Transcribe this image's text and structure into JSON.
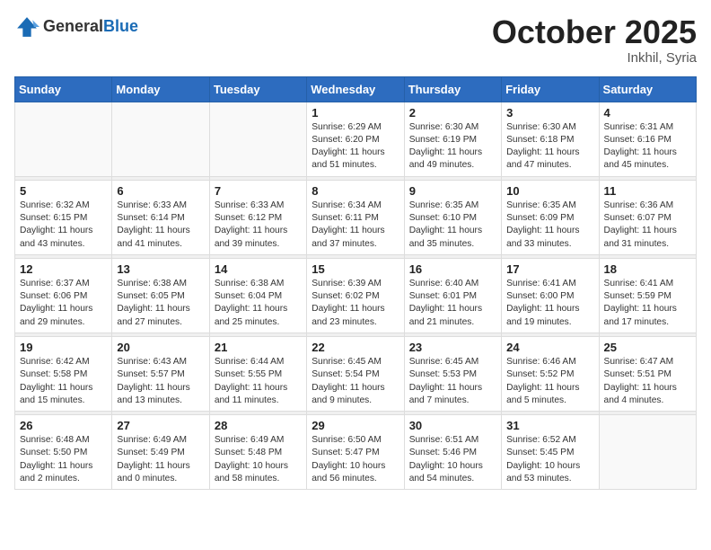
{
  "logo": {
    "general": "General",
    "blue": "Blue"
  },
  "title": "October 2025",
  "location": "Inkhil, Syria",
  "days_of_week": [
    "Sunday",
    "Monday",
    "Tuesday",
    "Wednesday",
    "Thursday",
    "Friday",
    "Saturday"
  ],
  "weeks": [
    [
      {
        "day": "",
        "info": ""
      },
      {
        "day": "",
        "info": ""
      },
      {
        "day": "",
        "info": ""
      },
      {
        "day": "1",
        "info": "Sunrise: 6:29 AM\nSunset: 6:20 PM\nDaylight: 11 hours\nand 51 minutes."
      },
      {
        "day": "2",
        "info": "Sunrise: 6:30 AM\nSunset: 6:19 PM\nDaylight: 11 hours\nand 49 minutes."
      },
      {
        "day": "3",
        "info": "Sunrise: 6:30 AM\nSunset: 6:18 PM\nDaylight: 11 hours\nand 47 minutes."
      },
      {
        "day": "4",
        "info": "Sunrise: 6:31 AM\nSunset: 6:16 PM\nDaylight: 11 hours\nand 45 minutes."
      }
    ],
    [
      {
        "day": "5",
        "info": "Sunrise: 6:32 AM\nSunset: 6:15 PM\nDaylight: 11 hours\nand 43 minutes."
      },
      {
        "day": "6",
        "info": "Sunrise: 6:33 AM\nSunset: 6:14 PM\nDaylight: 11 hours\nand 41 minutes."
      },
      {
        "day": "7",
        "info": "Sunrise: 6:33 AM\nSunset: 6:12 PM\nDaylight: 11 hours\nand 39 minutes."
      },
      {
        "day": "8",
        "info": "Sunrise: 6:34 AM\nSunset: 6:11 PM\nDaylight: 11 hours\nand 37 minutes."
      },
      {
        "day": "9",
        "info": "Sunrise: 6:35 AM\nSunset: 6:10 PM\nDaylight: 11 hours\nand 35 minutes."
      },
      {
        "day": "10",
        "info": "Sunrise: 6:35 AM\nSunset: 6:09 PM\nDaylight: 11 hours\nand 33 minutes."
      },
      {
        "day": "11",
        "info": "Sunrise: 6:36 AM\nSunset: 6:07 PM\nDaylight: 11 hours\nand 31 minutes."
      }
    ],
    [
      {
        "day": "12",
        "info": "Sunrise: 6:37 AM\nSunset: 6:06 PM\nDaylight: 11 hours\nand 29 minutes."
      },
      {
        "day": "13",
        "info": "Sunrise: 6:38 AM\nSunset: 6:05 PM\nDaylight: 11 hours\nand 27 minutes."
      },
      {
        "day": "14",
        "info": "Sunrise: 6:38 AM\nSunset: 6:04 PM\nDaylight: 11 hours\nand 25 minutes."
      },
      {
        "day": "15",
        "info": "Sunrise: 6:39 AM\nSunset: 6:02 PM\nDaylight: 11 hours\nand 23 minutes."
      },
      {
        "day": "16",
        "info": "Sunrise: 6:40 AM\nSunset: 6:01 PM\nDaylight: 11 hours\nand 21 minutes."
      },
      {
        "day": "17",
        "info": "Sunrise: 6:41 AM\nSunset: 6:00 PM\nDaylight: 11 hours\nand 19 minutes."
      },
      {
        "day": "18",
        "info": "Sunrise: 6:41 AM\nSunset: 5:59 PM\nDaylight: 11 hours\nand 17 minutes."
      }
    ],
    [
      {
        "day": "19",
        "info": "Sunrise: 6:42 AM\nSunset: 5:58 PM\nDaylight: 11 hours\nand 15 minutes."
      },
      {
        "day": "20",
        "info": "Sunrise: 6:43 AM\nSunset: 5:57 PM\nDaylight: 11 hours\nand 13 minutes."
      },
      {
        "day": "21",
        "info": "Sunrise: 6:44 AM\nSunset: 5:55 PM\nDaylight: 11 hours\nand 11 minutes."
      },
      {
        "day": "22",
        "info": "Sunrise: 6:45 AM\nSunset: 5:54 PM\nDaylight: 11 hours\nand 9 minutes."
      },
      {
        "day": "23",
        "info": "Sunrise: 6:45 AM\nSunset: 5:53 PM\nDaylight: 11 hours\nand 7 minutes."
      },
      {
        "day": "24",
        "info": "Sunrise: 6:46 AM\nSunset: 5:52 PM\nDaylight: 11 hours\nand 5 minutes."
      },
      {
        "day": "25",
        "info": "Sunrise: 6:47 AM\nSunset: 5:51 PM\nDaylight: 11 hours\nand 4 minutes."
      }
    ],
    [
      {
        "day": "26",
        "info": "Sunrise: 6:48 AM\nSunset: 5:50 PM\nDaylight: 11 hours\nand 2 minutes."
      },
      {
        "day": "27",
        "info": "Sunrise: 6:49 AM\nSunset: 5:49 PM\nDaylight: 11 hours\nand 0 minutes."
      },
      {
        "day": "28",
        "info": "Sunrise: 6:49 AM\nSunset: 5:48 PM\nDaylight: 10 hours\nand 58 minutes."
      },
      {
        "day": "29",
        "info": "Sunrise: 6:50 AM\nSunset: 5:47 PM\nDaylight: 10 hours\nand 56 minutes."
      },
      {
        "day": "30",
        "info": "Sunrise: 6:51 AM\nSunset: 5:46 PM\nDaylight: 10 hours\nand 54 minutes."
      },
      {
        "day": "31",
        "info": "Sunrise: 6:52 AM\nSunset: 5:45 PM\nDaylight: 10 hours\nand 53 minutes."
      },
      {
        "day": "",
        "info": ""
      }
    ]
  ]
}
